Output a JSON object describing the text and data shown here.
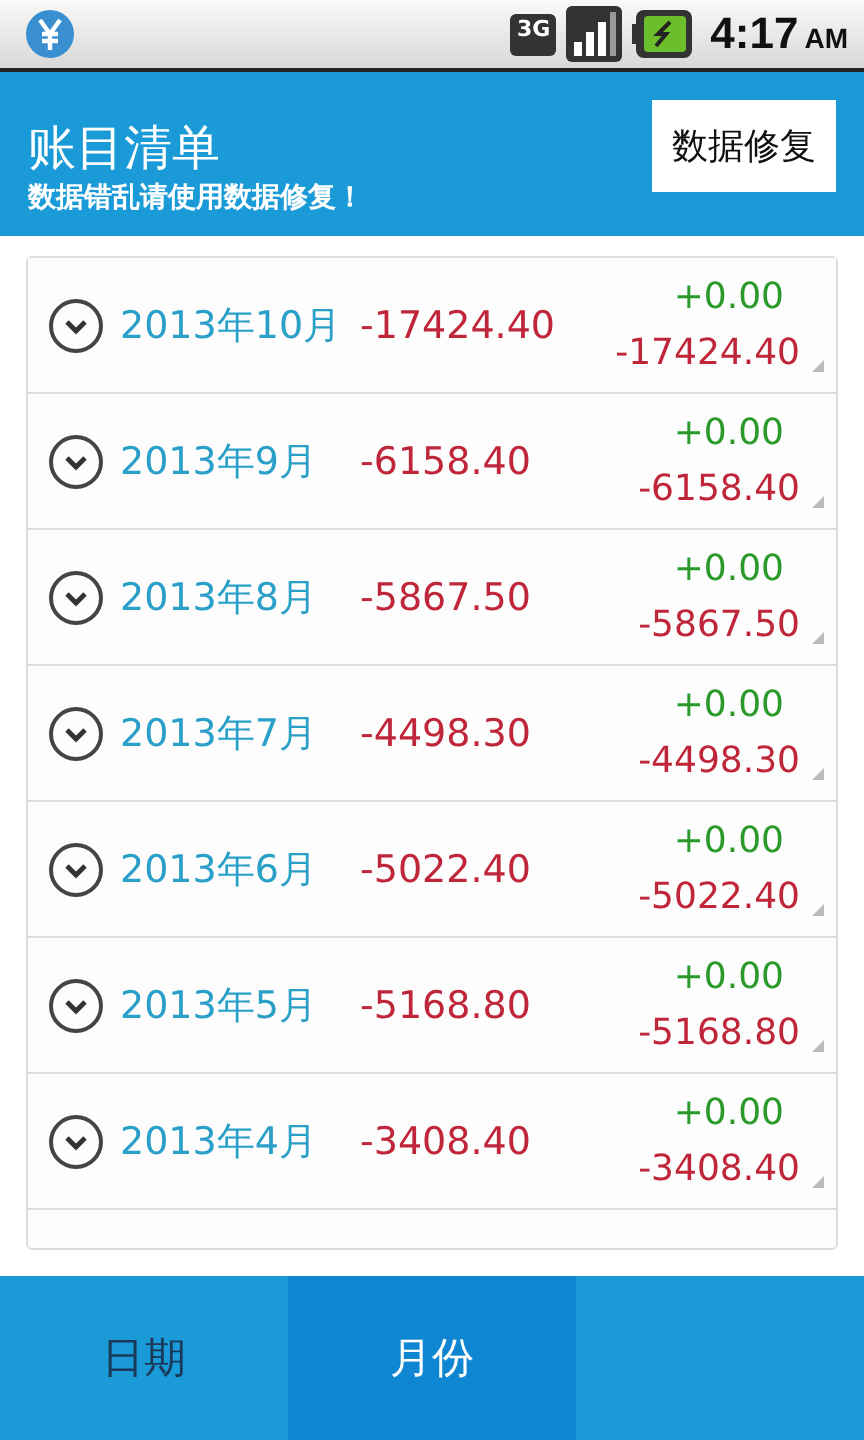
{
  "status_bar": {
    "time": "4:17",
    "ampm": "AM",
    "network": "3G"
  },
  "header": {
    "title": "账目清单",
    "subtitle": "数据错乱请使用数据修复！",
    "button": "数据修复"
  },
  "months": [
    {
      "label": "2013年10月",
      "total": "-17424.40",
      "income": "+0.00",
      "expense": "-17424.40"
    },
    {
      "label": "2013年9月",
      "total": "-6158.40",
      "income": "+0.00",
      "expense": "-6158.40"
    },
    {
      "label": "2013年8月",
      "total": "-5867.50",
      "income": "+0.00",
      "expense": "-5867.50"
    },
    {
      "label": "2013年7月",
      "total": "-4498.30",
      "income": "+0.00",
      "expense": "-4498.30"
    },
    {
      "label": "2013年6月",
      "total": "-5022.40",
      "income": "+0.00",
      "expense": "-5022.40"
    },
    {
      "label": "2013年5月",
      "total": "-5168.80",
      "income": "+0.00",
      "expense": "-5168.80"
    },
    {
      "label": "2013年4月",
      "total": "-3408.40",
      "income": "+0.00",
      "expense": "-3408.40"
    }
  ],
  "tabs": [
    {
      "label": "日期",
      "selected": false
    },
    {
      "label": "月份",
      "selected": true
    }
  ]
}
